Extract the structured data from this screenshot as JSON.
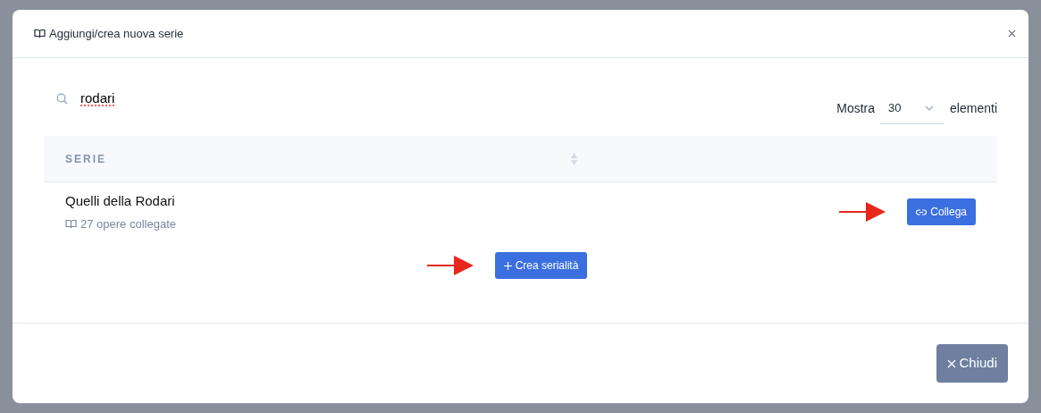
{
  "modal": {
    "title": "Aggiungi/crea nuova serie"
  },
  "search": {
    "value": "rodari"
  },
  "page_size": {
    "label_before": "Mostra",
    "value": "30",
    "label_after": "elementi"
  },
  "table": {
    "columns": [
      {
        "label": "SERIE",
        "sortable": true
      }
    ],
    "rows": [
      {
        "name": "Quelli della Rodari",
        "works": "27 opere collegate",
        "action": "Collega"
      }
    ]
  },
  "create_button": "Crea serialità",
  "footer": {
    "close_button": "Chiudi"
  }
}
